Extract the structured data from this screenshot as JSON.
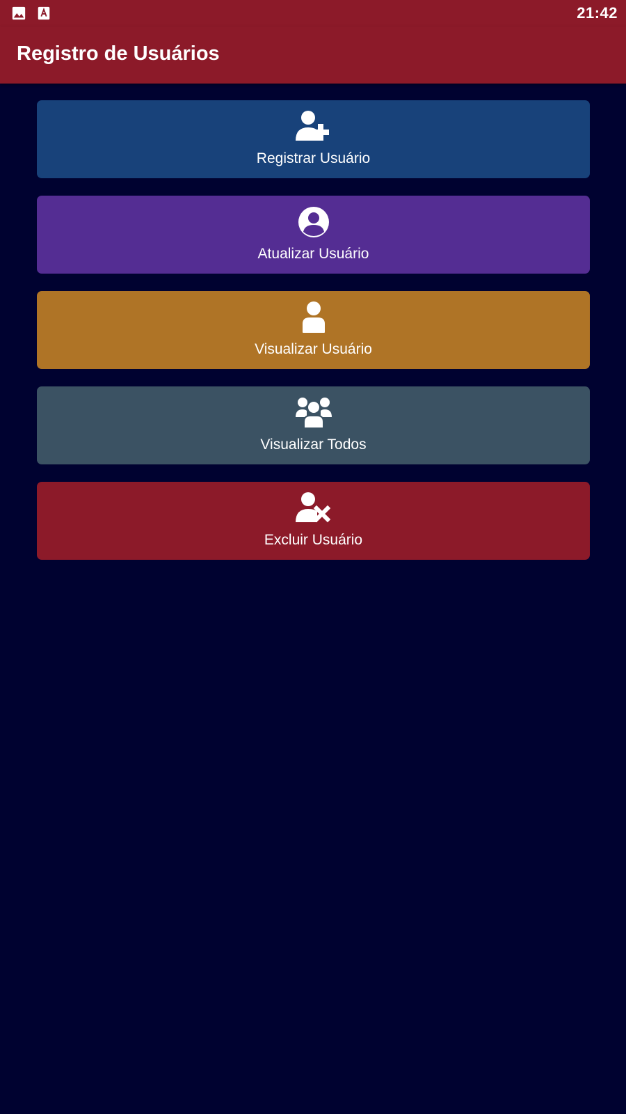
{
  "status_bar": {
    "time": "21:42",
    "icons": [
      "image-icon",
      "text-app-icon"
    ]
  },
  "app_bar": {
    "title": "Registro de Usuários"
  },
  "menu": {
    "items": [
      {
        "label": "Registrar Usuário",
        "icon": "user-plus-icon",
        "color": "#18427a"
      },
      {
        "label": "Atualizar Usuário",
        "icon": "user-circle-icon",
        "color": "#542d93"
      },
      {
        "label": "Visualizar Usuário",
        "icon": "user-icon",
        "color": "#af7426"
      },
      {
        "label": "Visualizar Todos",
        "icon": "users-group-icon",
        "color": "#3b5263"
      },
      {
        "label": "Excluir Usuário",
        "icon": "user-remove-icon",
        "color": "#8c1a29"
      }
    ]
  },
  "colors": {
    "background": "#000230",
    "app_bar": "#8c1a29"
  }
}
